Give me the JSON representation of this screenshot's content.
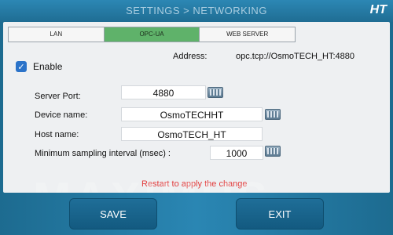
{
  "window": {
    "title": "SETTINGS > NETWORKING",
    "logo": "HT"
  },
  "tabs": [
    {
      "label": "LAN",
      "active": false
    },
    {
      "label": "OPC-UA",
      "active": true
    },
    {
      "label": "WEB SERVER",
      "active": false
    }
  ],
  "opcua": {
    "enable_label": "Enable",
    "enable_checked": true,
    "address_label": "Address:",
    "address_value": "opc.tcp://OsmoTECH_HT:4880",
    "server_port_label": "Server Port:",
    "server_port_value": "4880",
    "device_name_label": "Device name:",
    "device_name_value": "OsmoTECHHT",
    "host_name_label": "Host name:",
    "host_name_value": "OsmoTECH_HT",
    "min_sampling_label": "Minimum sampling interval (msec) :",
    "min_sampling_value": "1000",
    "restart_notice": "Restart to apply the change"
  },
  "watermark": "MAXIMUS",
  "buttons": {
    "save": "SAVE",
    "exit": "EXIT"
  },
  "icons": {
    "keyboard": "keyboard-icon",
    "check": "check-icon"
  },
  "colors": {
    "active_tab": "#5fb26a",
    "restart_text": "#e23b3b",
    "checkbox": "#2b73c9"
  }
}
